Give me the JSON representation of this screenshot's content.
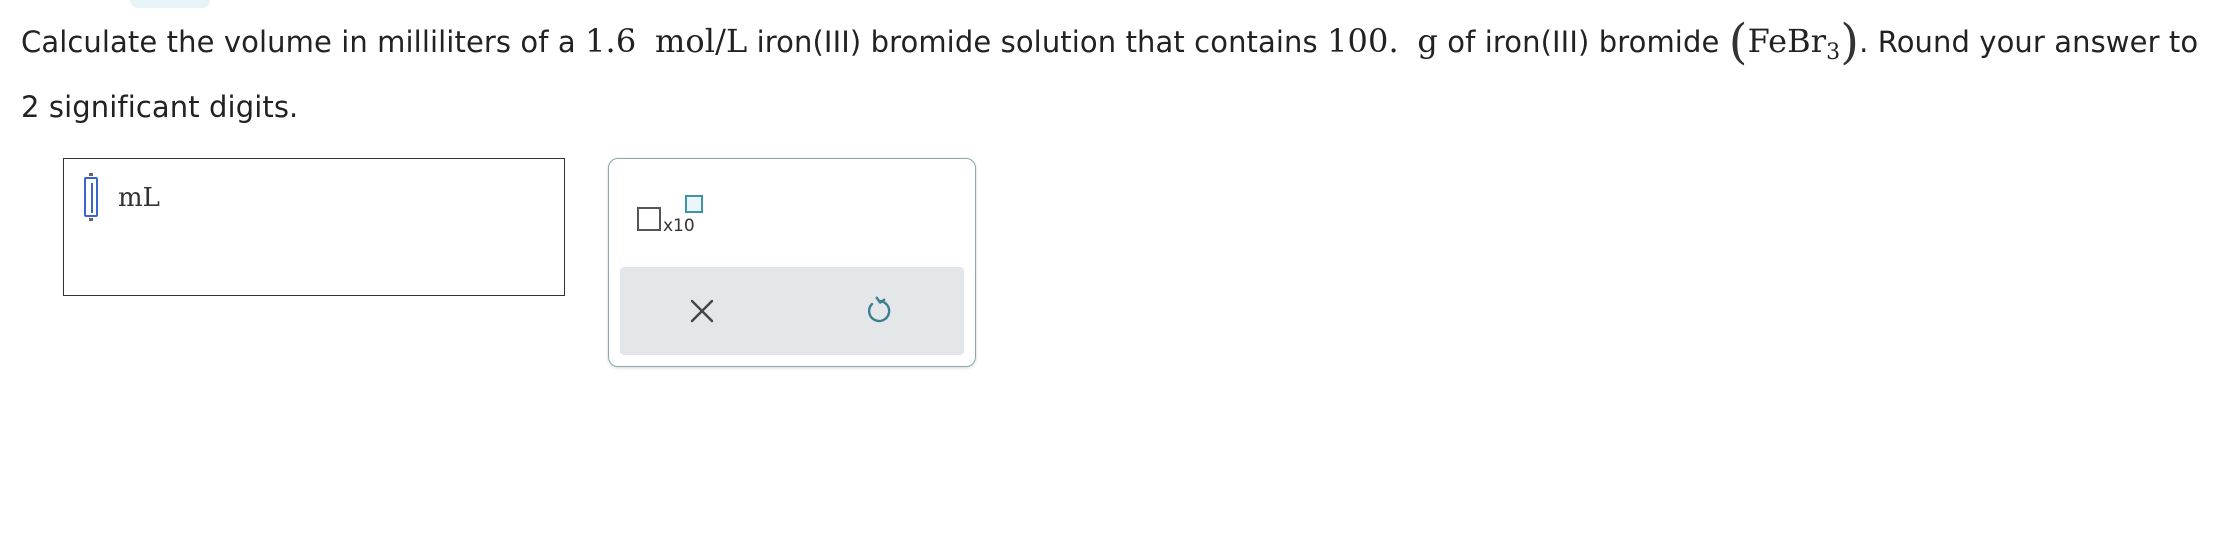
{
  "question": {
    "pre": "Calculate the volume in milliliters of a ",
    "concentration": "1.6",
    "unit_conc": "mol/L",
    "mid1": " iron(III) bromide solution that contains ",
    "mass": "100.",
    "unit_mass": "g",
    "mid2": " of iron(III) bromide ",
    "formula_base": "FeBr",
    "formula_sub": "3",
    "post": ". Round your answer to 2 significant digits."
  },
  "answer": {
    "value": "",
    "unit": "mL"
  },
  "tools": {
    "x10_label": "x10",
    "clear_icon": "close-icon",
    "undo_icon": "undo-icon"
  },
  "colors": {
    "cursor": "#3b63d1",
    "accent_teal": "#3d93a8",
    "action_bar": "#e3e7ea"
  }
}
